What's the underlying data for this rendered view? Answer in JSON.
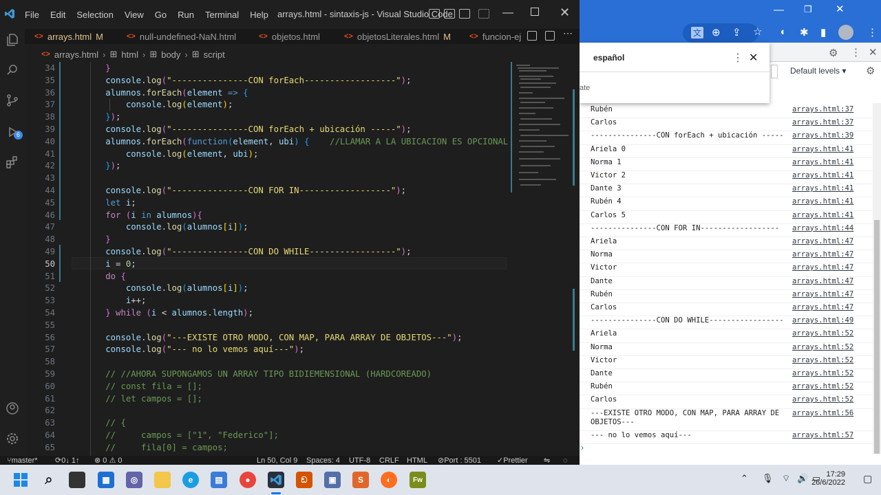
{
  "window": {
    "menu": [
      "File",
      "Edit",
      "Selection",
      "View",
      "Go",
      "Run",
      "Terminal",
      "Help"
    ],
    "title": "arrays.html - sintaxis-js - Visual Studio Code"
  },
  "tabs": [
    {
      "label": "arrays.html",
      "modified": "M"
    },
    {
      "label": "null-undefined-NaN.html",
      "modified": ""
    },
    {
      "label": "objetos.html",
      "modified": ""
    },
    {
      "label": "objetosLiterales.html",
      "modified": "M"
    },
    {
      "label": "funcion-ej",
      "modified": ""
    }
  ],
  "breadcrumb": [
    "arrays.html",
    "html",
    "body",
    "script"
  ],
  "editor": {
    "current_line": "50",
    "lines": [
      {
        "n": "34",
        "segs": [
          [
            "pn",
            "        "
          ],
          [
            "br2",
            "}"
          ]
        ]
      },
      {
        "n": "35",
        "segs": [
          [
            "pn",
            "        "
          ],
          [
            "var",
            "console"
          ],
          [
            "pn",
            "."
          ],
          [
            "fn",
            "log"
          ],
          [
            "br2",
            "("
          ],
          [
            "str2",
            "\"---------------CON forEach------------------\""
          ],
          [
            "br2",
            ")"
          ],
          [
            "pn",
            ";"
          ]
        ]
      },
      {
        "n": "36",
        "segs": [
          [
            "pn",
            "        "
          ],
          [
            "var",
            "alumnos"
          ],
          [
            "pn",
            "."
          ],
          [
            "fn",
            "forEach"
          ],
          [
            "br2",
            "("
          ],
          [
            "var",
            "element"
          ],
          [
            "kw",
            " => "
          ],
          [
            "br3",
            "{"
          ]
        ]
      },
      {
        "n": "37",
        "segs": [
          [
            "pn",
            "            "
          ],
          [
            "var",
            "console"
          ],
          [
            "pn",
            "."
          ],
          [
            "fn",
            "log"
          ],
          [
            "br1",
            "("
          ],
          [
            "var",
            "element"
          ],
          [
            "br1",
            ")"
          ],
          [
            "pn",
            ";"
          ]
        ]
      },
      {
        "n": "38",
        "segs": [
          [
            "pn",
            "        "
          ],
          [
            "br3",
            "}"
          ],
          [
            "br2",
            ")"
          ],
          [
            "pn",
            ";"
          ]
        ]
      },
      {
        "n": "39",
        "segs": [
          [
            "pn",
            "        "
          ],
          [
            "var",
            "console"
          ],
          [
            "pn",
            "."
          ],
          [
            "fn",
            "log"
          ],
          [
            "br2",
            "("
          ],
          [
            "str2",
            "\"---------------CON forEach + ubicación -----\""
          ],
          [
            "br2",
            ")"
          ],
          [
            "pn",
            ";"
          ]
        ]
      },
      {
        "n": "40",
        "segs": [
          [
            "pn",
            "        "
          ],
          [
            "var",
            "alumnos"
          ],
          [
            "pn",
            "."
          ],
          [
            "fn",
            "forEach"
          ],
          [
            "br2",
            "("
          ],
          [
            "kw",
            "function"
          ],
          [
            "br3",
            "("
          ],
          [
            "var",
            "element"
          ],
          [
            "pn",
            ", "
          ],
          [
            "var",
            "ubi"
          ],
          [
            "br3",
            ")"
          ],
          [
            "pn",
            " "
          ],
          [
            "br3",
            "{"
          ],
          [
            "pn",
            "    "
          ],
          [
            "cm",
            "//LLAMAR A LA UBICACION ES OPCIONAL"
          ]
        ]
      },
      {
        "n": "41",
        "segs": [
          [
            "pn",
            "            "
          ],
          [
            "var",
            "console"
          ],
          [
            "pn",
            "."
          ],
          [
            "fn",
            "log"
          ],
          [
            "br1",
            "("
          ],
          [
            "var",
            "element"
          ],
          [
            "pn",
            ", "
          ],
          [
            "var",
            "ubi"
          ],
          [
            "br1",
            ")"
          ],
          [
            "pn",
            ";"
          ]
        ]
      },
      {
        "n": "42",
        "segs": [
          [
            "pn",
            "        "
          ],
          [
            "br3",
            "}"
          ],
          [
            "br2",
            ")"
          ],
          [
            "pn",
            ";"
          ]
        ]
      },
      {
        "n": "43",
        "segs": [
          [
            "pn",
            ""
          ]
        ]
      },
      {
        "n": "44",
        "segs": [
          [
            "pn",
            "        "
          ],
          [
            "var",
            "console"
          ],
          [
            "pn",
            "."
          ],
          [
            "fn",
            "log"
          ],
          [
            "br2",
            "("
          ],
          [
            "str2",
            "\"---------------CON FOR IN------------------\""
          ],
          [
            "br2",
            ")"
          ],
          [
            "pn",
            ";"
          ]
        ]
      },
      {
        "n": "45",
        "segs": [
          [
            "pn",
            "        "
          ],
          [
            "kw",
            "let"
          ],
          [
            "pn",
            " "
          ],
          [
            "var",
            "i"
          ],
          [
            "pn",
            ";"
          ]
        ]
      },
      {
        "n": "46",
        "segs": [
          [
            "pn",
            "        "
          ],
          [
            "ctl",
            "for"
          ],
          [
            "pn",
            " "
          ],
          [
            "br2",
            "("
          ],
          [
            "var",
            "i"
          ],
          [
            "pn",
            " "
          ],
          [
            "kw",
            "in"
          ],
          [
            "pn",
            " "
          ],
          [
            "var",
            "alumnos"
          ],
          [
            "br2",
            ")"
          ],
          [
            "br2",
            "{"
          ]
        ]
      },
      {
        "n": "47",
        "segs": [
          [
            "pn",
            "            "
          ],
          [
            "var",
            "console"
          ],
          [
            "pn",
            "."
          ],
          [
            "fn",
            "log"
          ],
          [
            "br3",
            "("
          ],
          [
            "var",
            "alumnos"
          ],
          [
            "br1",
            "["
          ],
          [
            "var",
            "i"
          ],
          [
            "br1",
            "]"
          ],
          [
            "br3",
            ")"
          ],
          [
            "pn",
            ";"
          ]
        ]
      },
      {
        "n": "48",
        "segs": [
          [
            "pn",
            "        "
          ],
          [
            "br2",
            "}"
          ]
        ]
      },
      {
        "n": "49",
        "segs": [
          [
            "pn",
            "        "
          ],
          [
            "var",
            "console"
          ],
          [
            "pn",
            "."
          ],
          [
            "fn",
            "log"
          ],
          [
            "br2",
            "("
          ],
          [
            "str2",
            "\"---------------CON DO WHILE-----------------\""
          ],
          [
            "br2",
            ")"
          ],
          [
            "pn",
            ";"
          ]
        ]
      },
      {
        "n": "50",
        "segs": [
          [
            "pn",
            "        "
          ],
          [
            "var",
            "i"
          ],
          [
            "pn",
            " = "
          ],
          [
            "num",
            "0"
          ],
          [
            "pn",
            ";"
          ]
        ]
      },
      {
        "n": "51",
        "segs": [
          [
            "pn",
            "        "
          ],
          [
            "ctl",
            "do"
          ],
          [
            "pn",
            " "
          ],
          [
            "br2",
            "{"
          ]
        ]
      },
      {
        "n": "52",
        "segs": [
          [
            "pn",
            "            "
          ],
          [
            "var",
            "console"
          ],
          [
            "pn",
            "."
          ],
          [
            "fn",
            "log"
          ],
          [
            "br3",
            "("
          ],
          [
            "var",
            "alumnos"
          ],
          [
            "br1",
            "["
          ],
          [
            "var",
            "i"
          ],
          [
            "br1",
            "]"
          ],
          [
            "br3",
            ")"
          ],
          [
            "pn",
            ";"
          ]
        ]
      },
      {
        "n": "53",
        "segs": [
          [
            "pn",
            "            "
          ],
          [
            "var",
            "i"
          ],
          [
            "pn",
            "++;"
          ]
        ]
      },
      {
        "n": "54",
        "segs": [
          [
            "pn",
            "        "
          ],
          [
            "br2",
            "}"
          ],
          [
            "pn",
            " "
          ],
          [
            "ctl",
            "while"
          ],
          [
            "pn",
            " "
          ],
          [
            "br2",
            "("
          ],
          [
            "var",
            "i"
          ],
          [
            "pn",
            " < "
          ],
          [
            "var",
            "alumnos"
          ],
          [
            "pn",
            "."
          ],
          [
            "var",
            "length"
          ],
          [
            "br2",
            ")"
          ],
          [
            "pn",
            ";"
          ]
        ]
      },
      {
        "n": "55",
        "segs": [
          [
            "pn",
            ""
          ]
        ]
      },
      {
        "n": "56",
        "segs": [
          [
            "pn",
            "        "
          ],
          [
            "var",
            "console"
          ],
          [
            "pn",
            "."
          ],
          [
            "fn",
            "log"
          ],
          [
            "br2",
            "("
          ],
          [
            "str2",
            "\"---EXISTE OTRO MODO, CON MAP, PARA ARRAY DE OBJETOS---\""
          ],
          [
            "br2",
            ")"
          ],
          [
            "pn",
            ";"
          ]
        ]
      },
      {
        "n": "57",
        "segs": [
          [
            "pn",
            "        "
          ],
          [
            "var",
            "console"
          ],
          [
            "pn",
            "."
          ],
          [
            "fn",
            "log"
          ],
          [
            "br2",
            "("
          ],
          [
            "str2",
            "\"--- no lo vemos aquí---\""
          ],
          [
            "br2",
            ")"
          ],
          [
            "pn",
            ";"
          ]
        ]
      },
      {
        "n": "58",
        "segs": [
          [
            "pn",
            ""
          ]
        ]
      },
      {
        "n": "59",
        "segs": [
          [
            "pn",
            "        "
          ],
          [
            "cm",
            "// //AHORA SUPONGAMOS UN ARRAY TIPO BIDIEMENSIONAL (HARDCOREADO)"
          ]
        ]
      },
      {
        "n": "60",
        "segs": [
          [
            "pn",
            "        "
          ],
          [
            "cm",
            "// const fila = [];"
          ]
        ]
      },
      {
        "n": "61",
        "segs": [
          [
            "pn",
            "        "
          ],
          [
            "cm",
            "// let campos = [];"
          ]
        ]
      },
      {
        "n": "62",
        "segs": [
          [
            "pn",
            ""
          ]
        ]
      },
      {
        "n": "63",
        "segs": [
          [
            "pn",
            "        "
          ],
          [
            "cm",
            "// {"
          ]
        ]
      },
      {
        "n": "64",
        "segs": [
          [
            "pn",
            "        "
          ],
          [
            "cm",
            "//     campos = [\"1\", \"Federico\"];"
          ]
        ]
      },
      {
        "n": "65",
        "segs": [
          [
            "pn",
            "        "
          ],
          [
            "cm",
            "//     fila[0] = campos;"
          ]
        ]
      }
    ]
  },
  "statusbar": {
    "branch": "master*",
    "sync": "0↓ 1↑",
    "problems": "⊗ 0 ⚠ 0",
    "position": "Ln 50, Col 9",
    "spaces": "Spaces: 4",
    "encoding": "UTF-8",
    "eol": "CRLF",
    "language": "HTML",
    "port": "Port : 5501",
    "prettier": "Prettier"
  },
  "browser": {
    "translate_language": "español",
    "translate_hint": "ate",
    "levels_label": "Default levels"
  },
  "console": [
    {
      "msg": "Rubén",
      "src": "arrays.html:37"
    },
    {
      "msg": "Carlos",
      "src": "arrays.html:37"
    },
    {
      "msg": "---------------CON forEach + ubicación -----",
      "src": "arrays.html:39"
    },
    {
      "msg": "Ariela 0",
      "src": "arrays.html:41"
    },
    {
      "msg": "Norma 1",
      "src": "arrays.html:41"
    },
    {
      "msg": "Victor 2",
      "src": "arrays.html:41"
    },
    {
      "msg": "Dante 3",
      "src": "arrays.html:41"
    },
    {
      "msg": "Rubén 4",
      "src": "arrays.html:41"
    },
    {
      "msg": "Carlos 5",
      "src": "arrays.html:41"
    },
    {
      "msg": "---------------CON FOR IN------------------",
      "src": "arrays.html:44"
    },
    {
      "msg": "Ariela",
      "src": "arrays.html:47"
    },
    {
      "msg": "Norma",
      "src": "arrays.html:47"
    },
    {
      "msg": "Victor",
      "src": "arrays.html:47"
    },
    {
      "msg": "Dante",
      "src": "arrays.html:47"
    },
    {
      "msg": "Rubén",
      "src": "arrays.html:47"
    },
    {
      "msg": "Carlos",
      "src": "arrays.html:47"
    },
    {
      "msg": "---------------CON DO WHILE-----------------",
      "src": "arrays.html:49"
    },
    {
      "msg": "Ariela",
      "src": "arrays.html:52"
    },
    {
      "msg": "Norma",
      "src": "arrays.html:52"
    },
    {
      "msg": "Victor",
      "src": "arrays.html:52"
    },
    {
      "msg": "Dante",
      "src": "arrays.html:52"
    },
    {
      "msg": "Rubén",
      "src": "arrays.html:52"
    },
    {
      "msg": "Carlos",
      "src": "arrays.html:52"
    },
    {
      "msg": "---EXISTE OTRO MODO, CON MAP, PARA ARRAY DE OBJETOS---",
      "src": "arrays.html:56"
    },
    {
      "msg": "--- no lo vemos aquí---",
      "src": "arrays.html:57"
    }
  ],
  "taskbar": {
    "time": "17:29",
    "date": "26/6/2022"
  },
  "colors": {
    "vscode_bg": "#1e1e1e",
    "chrome_blue": "#2a6fd6",
    "string_yellow": "#e6db74",
    "taskbar": "#dfe4ec"
  }
}
